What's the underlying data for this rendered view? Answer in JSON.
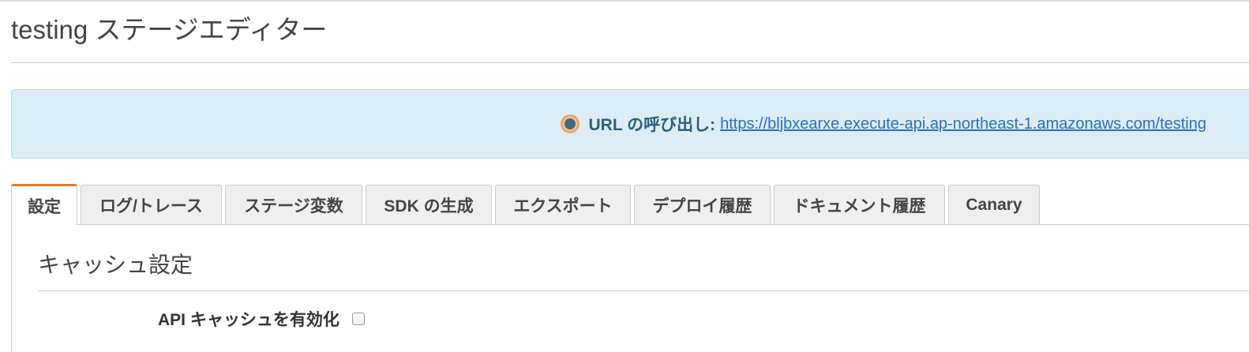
{
  "page": {
    "title": "testing ステージエディター"
  },
  "invoke": {
    "label": "URL の呼び出し:",
    "url": "https://bljbxearxe.execute-api.ap-northeast-1.amazonaws.com/testing",
    "icon": "status-dot-icon"
  },
  "tabs": [
    {
      "label": "設定",
      "active": true
    },
    {
      "label": "ログ/トレース",
      "active": false
    },
    {
      "label": "ステージ変数",
      "active": false
    },
    {
      "label": "SDK の生成",
      "active": false
    },
    {
      "label": "エクスポート",
      "active": false
    },
    {
      "label": "デプロイ履歴",
      "active": false
    },
    {
      "label": "ドキュメント履歴",
      "active": false
    },
    {
      "label": "Canary",
      "active": false
    }
  ],
  "cache": {
    "section_title": "キャッシュ設定",
    "enable_label": "API キャッシュを有効化",
    "enabled": false
  },
  "colors": {
    "accent_tab": "#e07b2a",
    "banner_bg": "#dcedf5",
    "link": "#2b6fc2"
  }
}
